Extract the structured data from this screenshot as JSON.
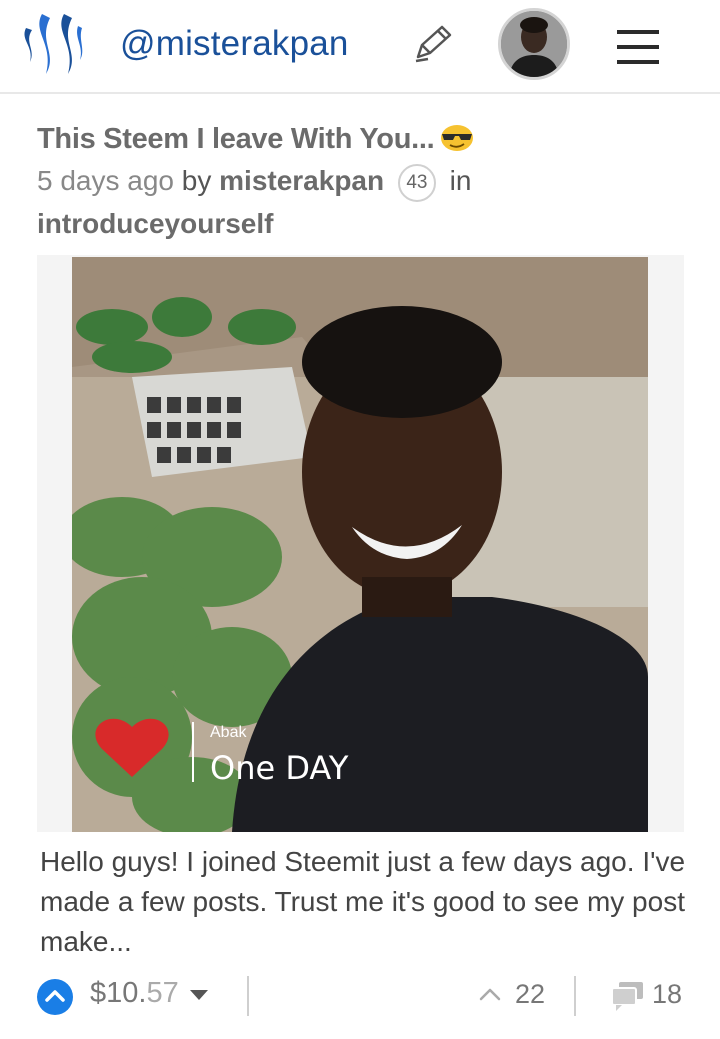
{
  "header": {
    "username": "@misterakpan",
    "icons": {
      "logo": "steem-logo-icon",
      "compose": "pen-icon",
      "avatar": "user-avatar",
      "menu": "hamburger-menu-icon"
    },
    "brand_color": "#1a5099"
  },
  "post": {
    "title": "This Steem I leave With You...",
    "title_emoji": "sunglasses-emoji-icon",
    "time_ago": "5 days ago",
    "by_label": "by",
    "author": "misterakpan",
    "reputation": "43",
    "in_label": "in",
    "category": "introduceyourself",
    "image": {
      "overlay_small": "Abak",
      "overlay_large": "One DAY"
    },
    "excerpt": "Hello guys! I joined Steemit just a few days ago. I've made a few posts. Trust me it's good to see my post make..."
  },
  "footer": {
    "payout_main": "$10.",
    "payout_cents": "57",
    "votes": "22",
    "comments": "18",
    "vote_color": "#1a7ee6"
  }
}
